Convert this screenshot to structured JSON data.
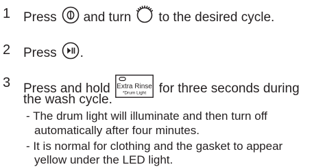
{
  "steps": [
    {
      "number": "1",
      "text_before": "Press",
      "text_middle": "and turn",
      "text_after": "to the desired cycle.",
      "icons": [
        "power-button-icon",
        "cycle-dial-icon"
      ]
    },
    {
      "number": "2",
      "text_before": "Press",
      "text_after": ".",
      "icons": [
        "start-pause-button-icon"
      ]
    },
    {
      "number": "3",
      "text_before": "Press and hold",
      "text_after": "for three seconds during",
      "continuation": "the wash cycle.",
      "button": {
        "label": "Extra Rinse",
        "sublabel": "*Drum Light"
      },
      "notes": [
        {
          "line1": "- The drum light will illuminate and then turn off",
          "line2": "automatically after four minutes."
        },
        {
          "line1": "- It is normal for clothing and the gasket to appear",
          "line2": "yellow under the LED light."
        }
      ]
    }
  ]
}
